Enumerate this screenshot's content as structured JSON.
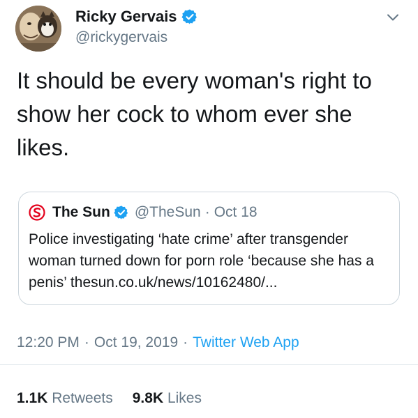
{
  "author": {
    "display_name": "Ricky Gervais",
    "handle": "@rickygervais",
    "verified_icon": "verified-badge-icon",
    "menu_icon": "chevron-down-icon"
  },
  "tweet": {
    "text": "It should be every woman's right to show her cock to whom ever she likes."
  },
  "quoted_tweet": {
    "logo_icon": "the-sun-logo-icon",
    "display_name": "The Sun",
    "handle": "@TheSun",
    "separator": "·",
    "date": "Oct 18",
    "text": "Police investigating ‘hate crime’ after transgender woman turned down for porn role ‘because she has a penis’ thesun.co.uk/news/10162480/..."
  },
  "meta": {
    "time": "12:20 PM",
    "separator": "·",
    "date": "Oct 19, 2019",
    "source": "Twitter Web App"
  },
  "stats": {
    "retweets_count": "1.1K",
    "retweets_label": "Retweets",
    "likes_count": "9.8K",
    "likes_label": "Likes"
  },
  "colors": {
    "text": "#14171a",
    "secondary": "#657786",
    "accent": "#1da1f2",
    "border": "#ccd6dd",
    "sun_red": "#e3001b"
  }
}
